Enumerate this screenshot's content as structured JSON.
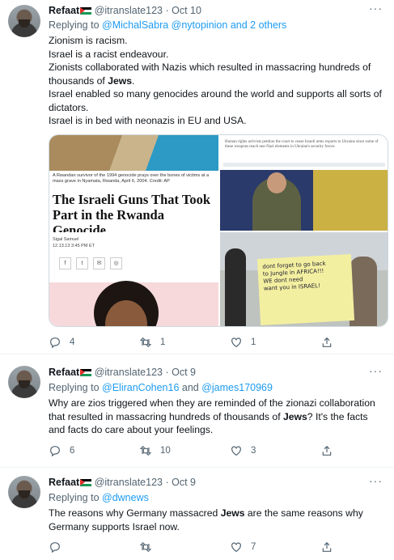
{
  "tweets": [
    {
      "name": "Refaat",
      "handle": "@itranslate123",
      "date": "Oct 10",
      "more": "···",
      "replying_prefix": "Replying to ",
      "replying_mentions": "@MichalSabra @nytopinion",
      "replying_suffix": " and 2 others",
      "lines": [
        "Zionism is racism.",
        "Israel is a racist endeavour.",
        "Zionists collaborated with Nazis which resulted in massacring hundreds of thousands of ",
        "Israel enabled so many genocides around the world and supports all sorts of dictators.",
        "Israel is in bed with neonazis in EU and USA."
      ],
      "bold_word": "Jews",
      "bold_after": ".",
      "media": {
        "caption": "A Rwandan survivor of the 1994 genocide prays over the bones of victims at a mass grave in Nyamata, Rwanda, April 6, 2004.  Credit: AP",
        "headline": "The Israeli Guns That Took Part in the Rwanda Genocide",
        "author": "Sigal Samuel",
        "byline_date": "12.13.13  3:45 PM ET",
        "share_icons": [
          "f",
          "t",
          "✉",
          "◎"
        ],
        "right_top_text": "Human rights activists petition the court to cease Israeli arms exports to Ukraine since some of these weapons reach neo-Nazi elements in Ukraine's security forces",
        "sign_lines": [
          "dont forget to go back",
          "to Jungle in AFRICA!!!",
          "WE dont need",
          "want you in ISRAEL!"
        ]
      },
      "counts": {
        "reply": "4",
        "retweet": "1",
        "like": "1"
      }
    },
    {
      "name": "Refaat",
      "handle": "@itranslate123",
      "date": "Oct 9",
      "more": "···",
      "replying_prefix": "Replying to ",
      "replying_mentions": "@EliranCohen16",
      "replying_and": " and ",
      "replying_mentions2": "@james170969",
      "text_before": "Why are zios triggered when they are reminded of the zionazi collaboration that resulted in massacring hundreds of thousands of ",
      "bold_word": "Jews",
      "text_after": "? It's the facts and facts do care about your feelings.",
      "counts": {
        "reply": "6",
        "retweet": "10",
        "like": "3"
      }
    },
    {
      "name": "Refaat",
      "handle": "@itranslate123",
      "date": "Oct 9",
      "more": "···",
      "replying_prefix": "Replying to ",
      "replying_mentions": "@dwnews",
      "text_before": "The reasons why Germany massacred ",
      "bold_word": "Jews",
      "text_after": " are the same reasons why Germany supports Israel now.",
      "counts": {
        "reply": "",
        "retweet": "",
        "like": "7"
      }
    }
  ]
}
